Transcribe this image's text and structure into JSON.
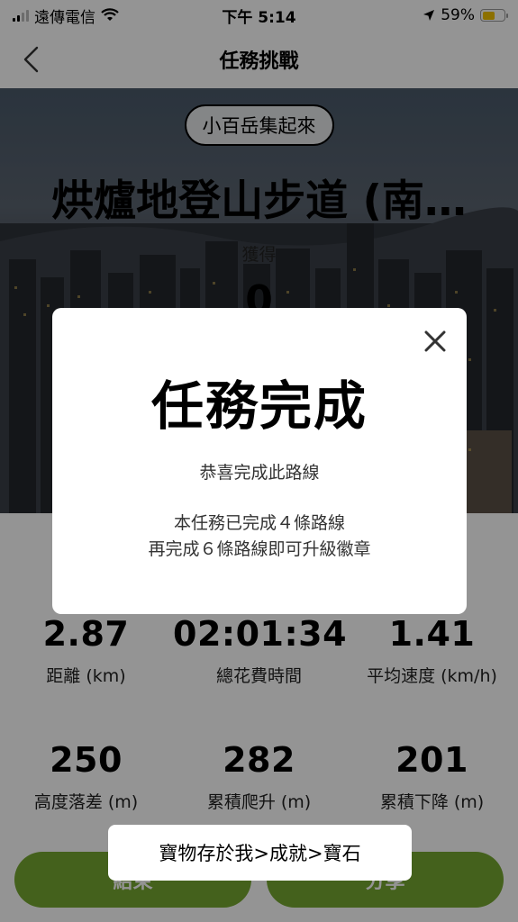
{
  "status_bar": {
    "carrier": "遠傳電信",
    "time": "下午 5:14",
    "battery_percent": "59%",
    "battery_level": 0.59,
    "icons": [
      "signal-icon",
      "wifi-icon",
      "location-arrow-icon",
      "battery-icon"
    ]
  },
  "nav": {
    "title": "任務挑戰",
    "back_icon": "chevron-left-icon"
  },
  "hero": {
    "tag": "小百岳集起來",
    "title": "烘爐地登山步道 (南…",
    "earn_label": "獲得",
    "earn_count": "0"
  },
  "stats": [
    {
      "value": "2.87",
      "label": "距離 (km)"
    },
    {
      "value": "02:01:34",
      "label": "總花費時間"
    },
    {
      "value": "1.41",
      "label": "平均速度 (km/h)"
    },
    {
      "value": "250",
      "label": "高度落差 (m)"
    },
    {
      "value": "282",
      "label": "累積爬升 (m)"
    },
    {
      "value": "201",
      "label": "累積下降 (m)"
    }
  ],
  "buttons": {
    "end": "結束",
    "share": "分享"
  },
  "modal": {
    "title": "任務完成",
    "subtitle": "恭喜完成此路線",
    "line1": "本任務已完成４條路線",
    "line2": "再完成６條路線即可升級徽章",
    "close_icon": "close-icon"
  },
  "toast": {
    "text": "寶物存於我>成就>寶石"
  },
  "colors": {
    "accent_green": "#76a831",
    "battery_yellow": "#f2c200"
  }
}
